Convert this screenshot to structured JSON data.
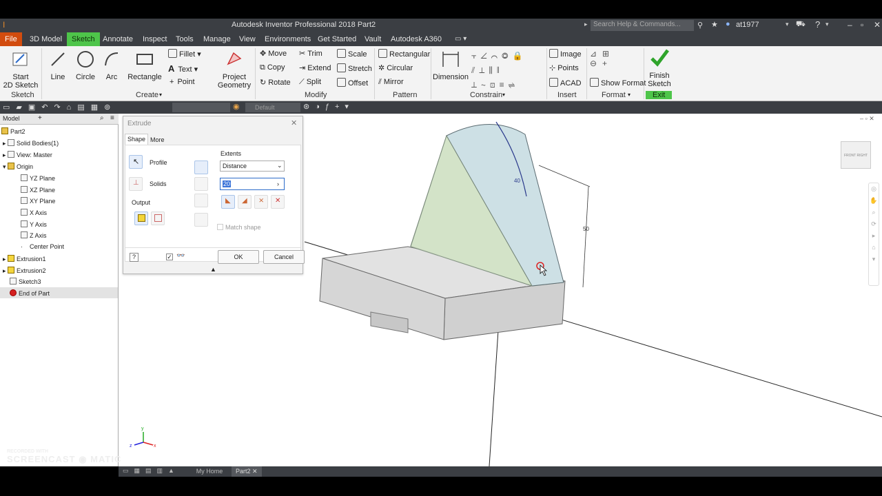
{
  "window": {
    "title": "Autodesk Inventor Professional 2018    Part2",
    "search_placeholder": "Search Help & Commands...",
    "user": "at1977"
  },
  "tabs": [
    "File",
    "3D Model",
    "Sketch",
    "Annotate",
    "Inspect",
    "Tools",
    "Manage",
    "View",
    "Environments",
    "Get Started",
    "Vault",
    "Autodesk A360"
  ],
  "active_tab": "Sketch",
  "ribbon": {
    "sketch": {
      "start_line1": "Start",
      "start_line2": "2D Sketch",
      "panel": "Sketch"
    },
    "create": {
      "line": "Line",
      "circle": "Circle",
      "arc": "Arc",
      "rectangle": "Rectangle",
      "fillet": "Fillet",
      "text": "Text",
      "point": "Point",
      "project_line1": "Project",
      "project_line2": "Geometry",
      "panel": "Create"
    },
    "modify": {
      "move": "Move",
      "copy": "Copy",
      "rotate": "Rotate",
      "trim": "Trim",
      "extend": "Extend",
      "split": "Split",
      "scale": "Scale",
      "stretch": "Stretch",
      "offset": "Offset",
      "panel": "Modify"
    },
    "pattern": {
      "rectangular": "Rectangular",
      "circular": "Circular",
      "mirror": "Mirror",
      "panel": "Pattern"
    },
    "constrain": {
      "dimension": "Dimension",
      "panel": "Constrain"
    },
    "insert": {
      "image": "Image",
      "points": "Points",
      "acad": "ACAD",
      "panel": "Insert"
    },
    "format": {
      "show_format": "Show Format",
      "panel": "Format"
    },
    "exit": {
      "finish_line1": "Finish",
      "finish_line2": "Sketch",
      "panel": "Exit"
    }
  },
  "qat": {
    "appearance": "Default"
  },
  "browser": {
    "tab": "Model",
    "items": [
      {
        "label": "Part2",
        "level": 0,
        "icon": "part-icon"
      },
      {
        "label": "Solid Bodies(1)",
        "level": 1,
        "icon": "solid-bodies-icon"
      },
      {
        "label": "View: Master",
        "level": 1,
        "icon": "view-icon"
      },
      {
        "label": "Origin",
        "level": 1,
        "icon": "origin-folder-icon"
      },
      {
        "label": "YZ Plane",
        "level": 2,
        "icon": "plane-icon"
      },
      {
        "label": "XZ Plane",
        "level": 2,
        "icon": "plane-icon"
      },
      {
        "label": "XY Plane",
        "level": 2,
        "icon": "plane-icon"
      },
      {
        "label": "X Axis",
        "level": 2,
        "icon": "axis-icon"
      },
      {
        "label": "Y Axis",
        "level": 2,
        "icon": "axis-icon"
      },
      {
        "label": "Z Axis",
        "level": 2,
        "icon": "axis-icon"
      },
      {
        "label": "Center Point",
        "level": 2,
        "icon": "point-icon"
      },
      {
        "label": "Extrusion1",
        "level": 1,
        "icon": "extrusion-icon"
      },
      {
        "label": "Extrusion2",
        "level": 1,
        "icon": "extrusion-icon"
      },
      {
        "label": "Sketch3",
        "level": 1,
        "icon": "sketch-icon"
      },
      {
        "label": "End of Part",
        "level": 1,
        "icon": "end-of-part-icon"
      }
    ]
  },
  "dialog": {
    "title": "Extrude",
    "tab_shape": "Shape",
    "tab_more": "More",
    "profile": "Profile",
    "solids": "Solids",
    "output": "Output",
    "extents": "Extents",
    "extents_value": "Distance",
    "distance_value": "20",
    "match_shape": "Match shape",
    "ok": "OK",
    "cancel": "Cancel"
  },
  "viewport": {
    "dim_angle": "40",
    "dim_height": "50",
    "axis_x": "x",
    "axis_y": "y",
    "axis_z": "z",
    "viewcube_front": "FRONT",
    "viewcube_right": "RIGHT"
  },
  "bottom_tabs": {
    "home": "My Home",
    "part": "Part2"
  },
  "watermark": {
    "line1": "RECORDED WITH",
    "line2": "SCREENCAST",
    "line3": "MATIC"
  }
}
